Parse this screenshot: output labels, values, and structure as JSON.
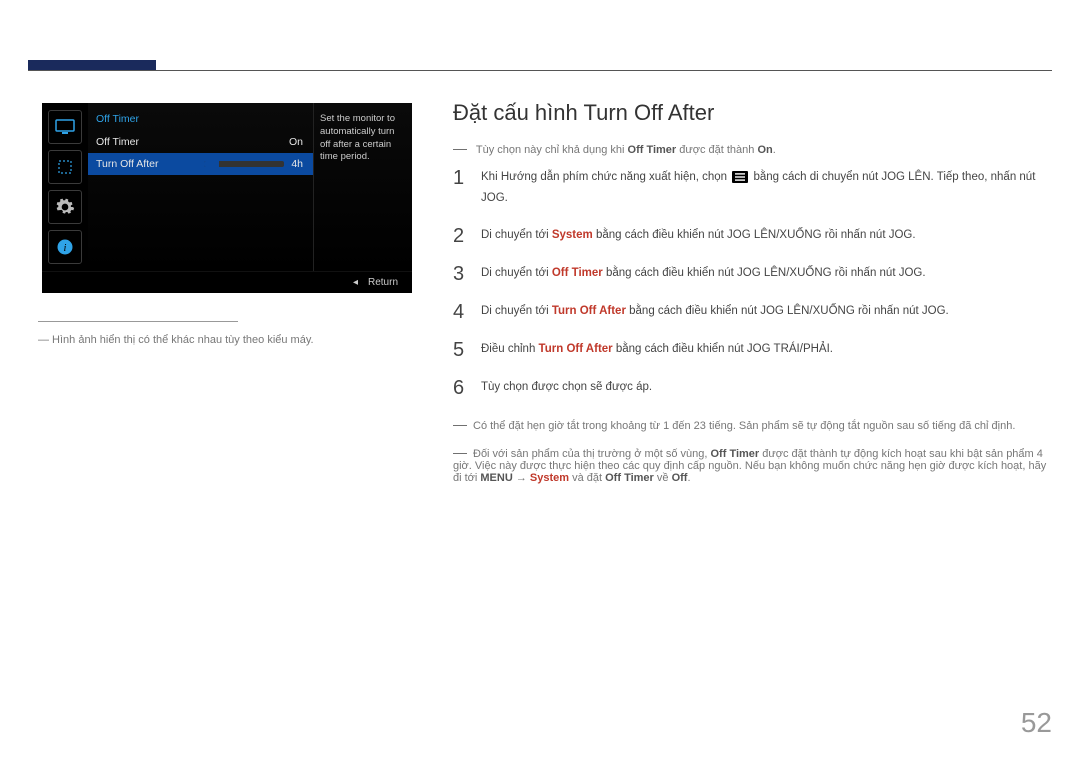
{
  "osd": {
    "title": "Off Timer",
    "rows": [
      {
        "label": "Off Timer",
        "value": "On"
      },
      {
        "label": "Turn Off After",
        "value": "4h"
      }
    ],
    "side_desc": "Set the monitor to automatically turn off after a certain time period.",
    "return_label": "Return"
  },
  "left_note": "―  Hình ảnh hiển thị có thể khác nhau tùy theo kiểu máy.",
  "heading": "Đặt cấu hình Turn Off After",
  "intro_note": {
    "prefix": "Tùy chọn này chỉ khả dụng khi ",
    "strong1": "Off Timer",
    "mid": " được đặt thành ",
    "strong2": "On",
    "suffix": "."
  },
  "steps": [
    {
      "num": "1",
      "parts": [
        "Khi Hướng dẫn phím chức năng xuất hiện, chọn ",
        "ICON_MENU",
        " bằng cách di chuyển nút JOG LÊN. Tiếp theo, nhấn nút JOG."
      ]
    },
    {
      "num": "2",
      "parts": [
        "Di chuyển tới ",
        {
          "emph": "System"
        },
        " bằng cách điều khiển nút JOG LÊN/XUỐNG rồi nhấn nút JOG."
      ]
    },
    {
      "num": "3",
      "parts": [
        "Di chuyển tới ",
        {
          "emph": "Off Timer"
        },
        " bằng cách điều khiển nút JOG LÊN/XUỐNG rồi nhấn nút JOG."
      ]
    },
    {
      "num": "4",
      "parts": [
        "Di chuyển tới ",
        {
          "emph": "Turn Off After"
        },
        " bằng cách điều khiển nút JOG LÊN/XUỐNG rồi nhấn nút JOG."
      ]
    },
    {
      "num": "5",
      "parts": [
        "Điều chỉnh ",
        {
          "emph": "Turn Off After"
        },
        " bằng cách điều khiển nút JOG TRÁI/PHẢI."
      ]
    },
    {
      "num": "6",
      "parts": [
        "Tùy chọn được chọn sẽ được áp."
      ]
    }
  ],
  "footnotes": [
    {
      "parts": [
        "Có thể đặt hẹn giờ tắt trong khoảng từ 1 đến 23 tiếng. Sản phẩm sẽ tự động tắt nguồn sau số tiếng đã chỉ định."
      ]
    },
    {
      "parts": [
        "Đối với sản phẩm của thị trường ở một số vùng, ",
        {
          "strong": "Off Timer"
        },
        " được đặt thành tự động kích hoạt sau khi bật sản phẩm 4 giờ. Việc này được thực hiện theo các quy định cấp nguồn. Nếu bạn không muốn chức năng hẹn giờ được kích hoạt, hãy đi tới ",
        {
          "strong": "MENU"
        },
        " → ",
        {
          "emph": "System"
        },
        " và đặt ",
        {
          "strong": "Off Timer"
        },
        " về ",
        {
          "strong": "Off"
        },
        "."
      ]
    }
  ],
  "page_number": "52"
}
